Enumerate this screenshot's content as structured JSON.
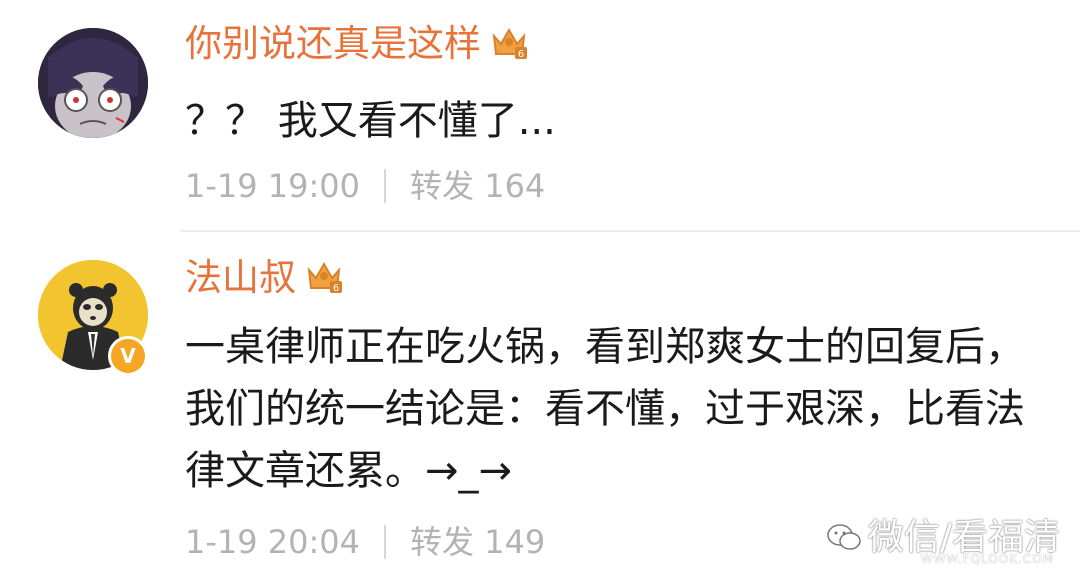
{
  "comments": [
    {
      "username": "你别说还真是这样",
      "text": "？？ 我又看不懂了...",
      "time": "1-19 19:00",
      "repost_label": "转发",
      "repost_count": "164"
    },
    {
      "username": "法山叔",
      "text": "一桌律师正在吃火锅，看到郑爽女士的回复后，我们的统一结论是：看不懂，过于艰深，比看法律文章还累。→_→",
      "time": "1-19 20:04",
      "repost_label": "转发",
      "repost_count": "149",
      "verified_badge": "V"
    }
  ],
  "watermark": {
    "text": "微信/看福清",
    "url": "WWW.FQLOOK.COM"
  },
  "colors": {
    "username": "#e8733a",
    "meta": "#b3b3b3",
    "crown": "#f0a040",
    "verified": "#f5a623"
  }
}
